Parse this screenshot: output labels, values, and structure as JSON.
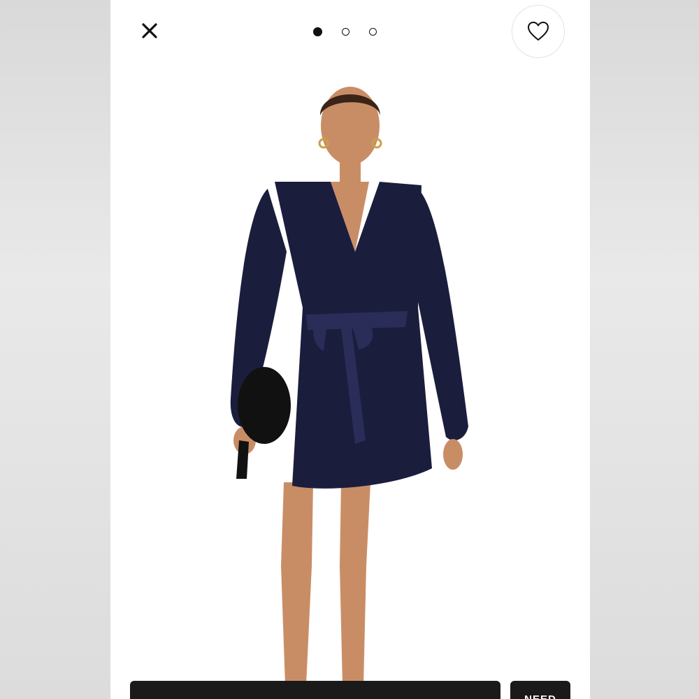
{
  "top_bar": {
    "close_icon": "close-icon",
    "carousel": {
      "total": 3,
      "active": 1
    },
    "favorite_icon": "heart-icon"
  },
  "product_image": {
    "icon": "product-photo"
  },
  "bottom_actions": {
    "need_label": "NEED"
  },
  "colors": {
    "dress": "#1b1d3d",
    "background": "#ffffff",
    "button": "#1a1a1a"
  }
}
